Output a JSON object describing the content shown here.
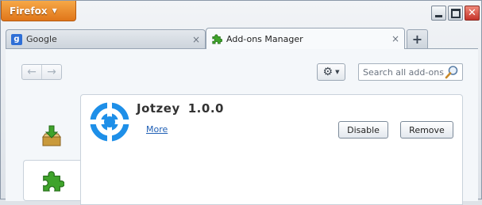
{
  "app_button": {
    "label": "Firefox"
  },
  "tabs": [
    {
      "title": "Google",
      "icon": "google-favicon",
      "active": false
    },
    {
      "title": "Add-ons Manager",
      "icon": "puzzle-piece-icon",
      "active": true
    }
  ],
  "new_tab_symbol": "+",
  "tab_close_symbol": "×",
  "toolbar": {
    "back_symbol": "←",
    "forward_symbol": "→",
    "search_placeholder": "Search all add-ons"
  },
  "addon": {
    "name": "Jotzey",
    "version": "1.0.0",
    "more_link": "More",
    "disable_label": "Disable",
    "remove_label": "Remove"
  },
  "colors": {
    "app_button": "#e0761a",
    "addon_icon": "#1e8fe8",
    "link": "#1f5fb5",
    "close_button": "#c5332a"
  }
}
